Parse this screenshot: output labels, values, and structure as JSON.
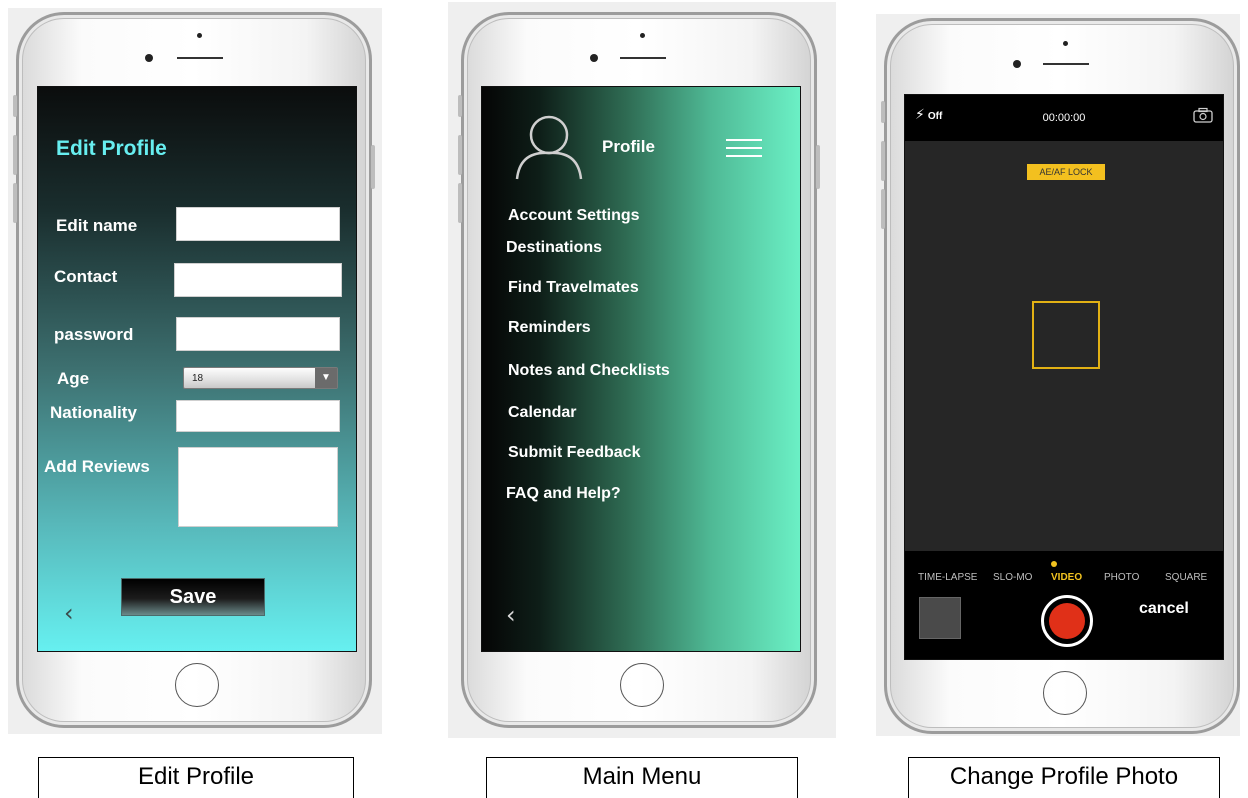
{
  "edit_profile": {
    "title": "Edit Profile",
    "fields": {
      "name_label": "Edit name",
      "contact_label": "Contact",
      "password_label": "password",
      "age_label": "Age",
      "age_value": "18",
      "nationality_label": "Nationality",
      "reviews_label": "Add Reviews"
    },
    "save_label": "Save",
    "back_glyph": "‹"
  },
  "main_menu": {
    "title": "Profile",
    "items": [
      "Account Settings",
      "Destinations",
      "Find Travelmates",
      "Reminders",
      "Notes and Checklists",
      "Calendar",
      "Submit Feedback",
      "FAQ and Help?"
    ],
    "back_glyph": "‹"
  },
  "camera": {
    "flash_label": "Off",
    "timer": "00:00:00",
    "lock_label": "AE/AF LOCK",
    "modes": [
      "TIME-LAPSE",
      "SLO-MO",
      "VIDEO",
      "PHOTO",
      "SQUARE"
    ],
    "active_mode": "VIDEO",
    "cancel_label": "cancel",
    "colors": {
      "accent": "#f2c320",
      "record": "#e03018"
    }
  },
  "captions": {
    "edit_profile": "Edit Profile",
    "main_menu": "Main Menu",
    "camera": "Change Profile Photo"
  }
}
